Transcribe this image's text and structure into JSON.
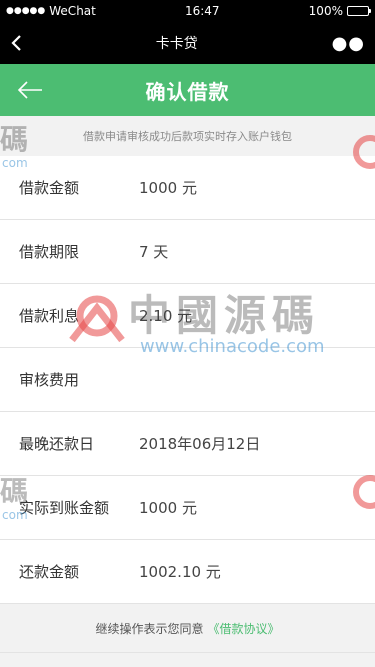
{
  "status_bar": {
    "signal": "●●●●●",
    "carrier": "WeChat",
    "time": "16:47",
    "battery_text": "100%"
  },
  "wechat_bar": {
    "back_icon": "chevron-left-icon",
    "title": "卡卡贷",
    "more_icon": "more-dots-icon",
    "more_text": "●●"
  },
  "header": {
    "back_icon": "arrow-left-icon",
    "title": "确认借款",
    "color": "#4cbd72"
  },
  "notice": "借款申请审核成功后款项实时存入账户钱包",
  "rows": [
    {
      "label": "借款金额",
      "value": "1000 元"
    },
    {
      "label": "借款期限",
      "value": "7 天"
    },
    {
      "label": "借款利息",
      "value": "2.10 元"
    },
    {
      "label": "审核费用",
      "value": ""
    },
    {
      "label": "最晚还款日",
      "value": "2018年06月12日"
    },
    {
      "label": "实际到账金额",
      "value": "1000 元"
    },
    {
      "label": "还款金额",
      "value": "1002.10 元"
    }
  ],
  "footer": {
    "text": "继续操作表示您同意",
    "link": "《借款协议》"
  },
  "watermark": {
    "main": "中國源碼",
    "url": "www.chinacode.com",
    "side": "碼",
    "side_url": "com"
  }
}
